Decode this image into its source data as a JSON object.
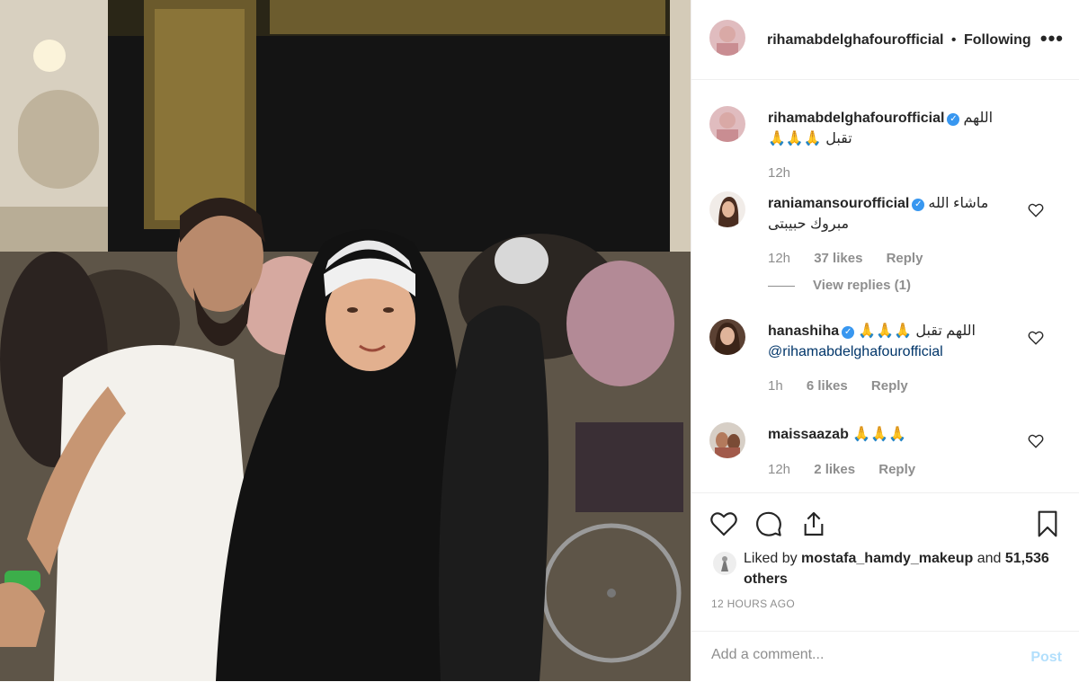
{
  "colors": {
    "accent": "#3897f0",
    "link": "#003569",
    "muted": "#8e8e8e",
    "post_disabled": "#b2dffc"
  },
  "header": {
    "username": "rihamabdelghafourofficial",
    "separator": "•",
    "follow_status": "Following",
    "more_icon": "more-horizontal-icon",
    "more_label": "•••"
  },
  "comments": [
    {
      "username": "rihamabdelghafourofficial",
      "verified": true,
      "text_line1": "اللهم",
      "text_line2": "تقبل 🙏🙏🙏",
      "time": "12h"
    },
    {
      "username": "raniamansourofficial",
      "verified": true,
      "text_line1": "ماشاء الله",
      "text_line2": "مبروك حبيبتى",
      "time": "12h",
      "likes": "37 likes",
      "reply": "Reply",
      "view_replies": "View replies (1)"
    },
    {
      "username": "hanashiha",
      "verified": true,
      "text_line1": "اللهم تقبل 🙏🙏🙏",
      "mention": "@rihamabdelghafourofficial",
      "time": "1h",
      "likes": "6 likes",
      "reply": "Reply"
    },
    {
      "username": "maissaazab",
      "verified": false,
      "text_line1": "🙏🙏🙏",
      "time": "12h",
      "likes": "2 likes",
      "reply": "Reply"
    }
  ],
  "actions": {
    "like_icon": "heart-icon",
    "comment_icon": "comment-icon",
    "share_icon": "share-icon",
    "save_icon": "bookmark-icon"
  },
  "likes": {
    "prefix": "Liked by",
    "user": "mostafa_hamdy_makeup",
    "and": "and",
    "others": "51,536 others"
  },
  "timestamp": "12 HOURS AGO",
  "add_comment": {
    "placeholder": "Add a comment...",
    "post_label": "Post"
  }
}
